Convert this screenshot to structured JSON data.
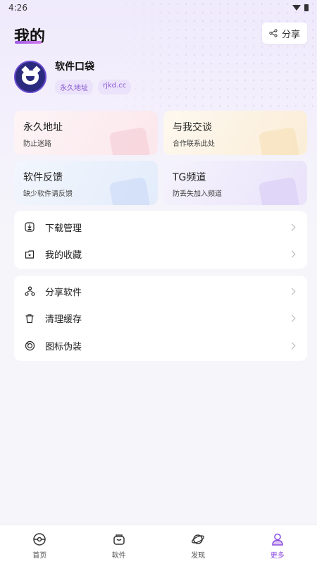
{
  "status": {
    "time": "4:26"
  },
  "header": {
    "title": "我的",
    "share_label": "分享"
  },
  "profile": {
    "name": "软件口袋",
    "tags": [
      "永久地址",
      "rjkd.cc"
    ]
  },
  "cards": [
    {
      "title": "永久地址",
      "subtitle": "防止迷路"
    },
    {
      "title": "与我交谈",
      "subtitle": "合作联系此处"
    },
    {
      "title": "软件反馈",
      "subtitle": "缺少软件请反馈"
    },
    {
      "title": "TG频道",
      "subtitle": "防丢失加入频道"
    }
  ],
  "menu1": [
    {
      "label": "下载管理",
      "icon": "download-icon"
    },
    {
      "label": "我的收藏",
      "icon": "favorite-folder-icon"
    }
  ],
  "menu2": [
    {
      "label": "分享软件",
      "icon": "share-nodes-icon"
    },
    {
      "label": "清理缓存",
      "icon": "trash-icon"
    },
    {
      "label": "图标伪装",
      "icon": "disguise-icon"
    }
  ],
  "tabs": [
    {
      "label": "首页",
      "icon": "home-icon"
    },
    {
      "label": "软件",
      "icon": "software-icon"
    },
    {
      "label": "发现",
      "icon": "discover-icon"
    },
    {
      "label": "更多",
      "icon": "user-icon",
      "active": true
    }
  ],
  "colors": {
    "accent": "#8b4fe0",
    "tag_bg": "#ebe2fb"
  }
}
